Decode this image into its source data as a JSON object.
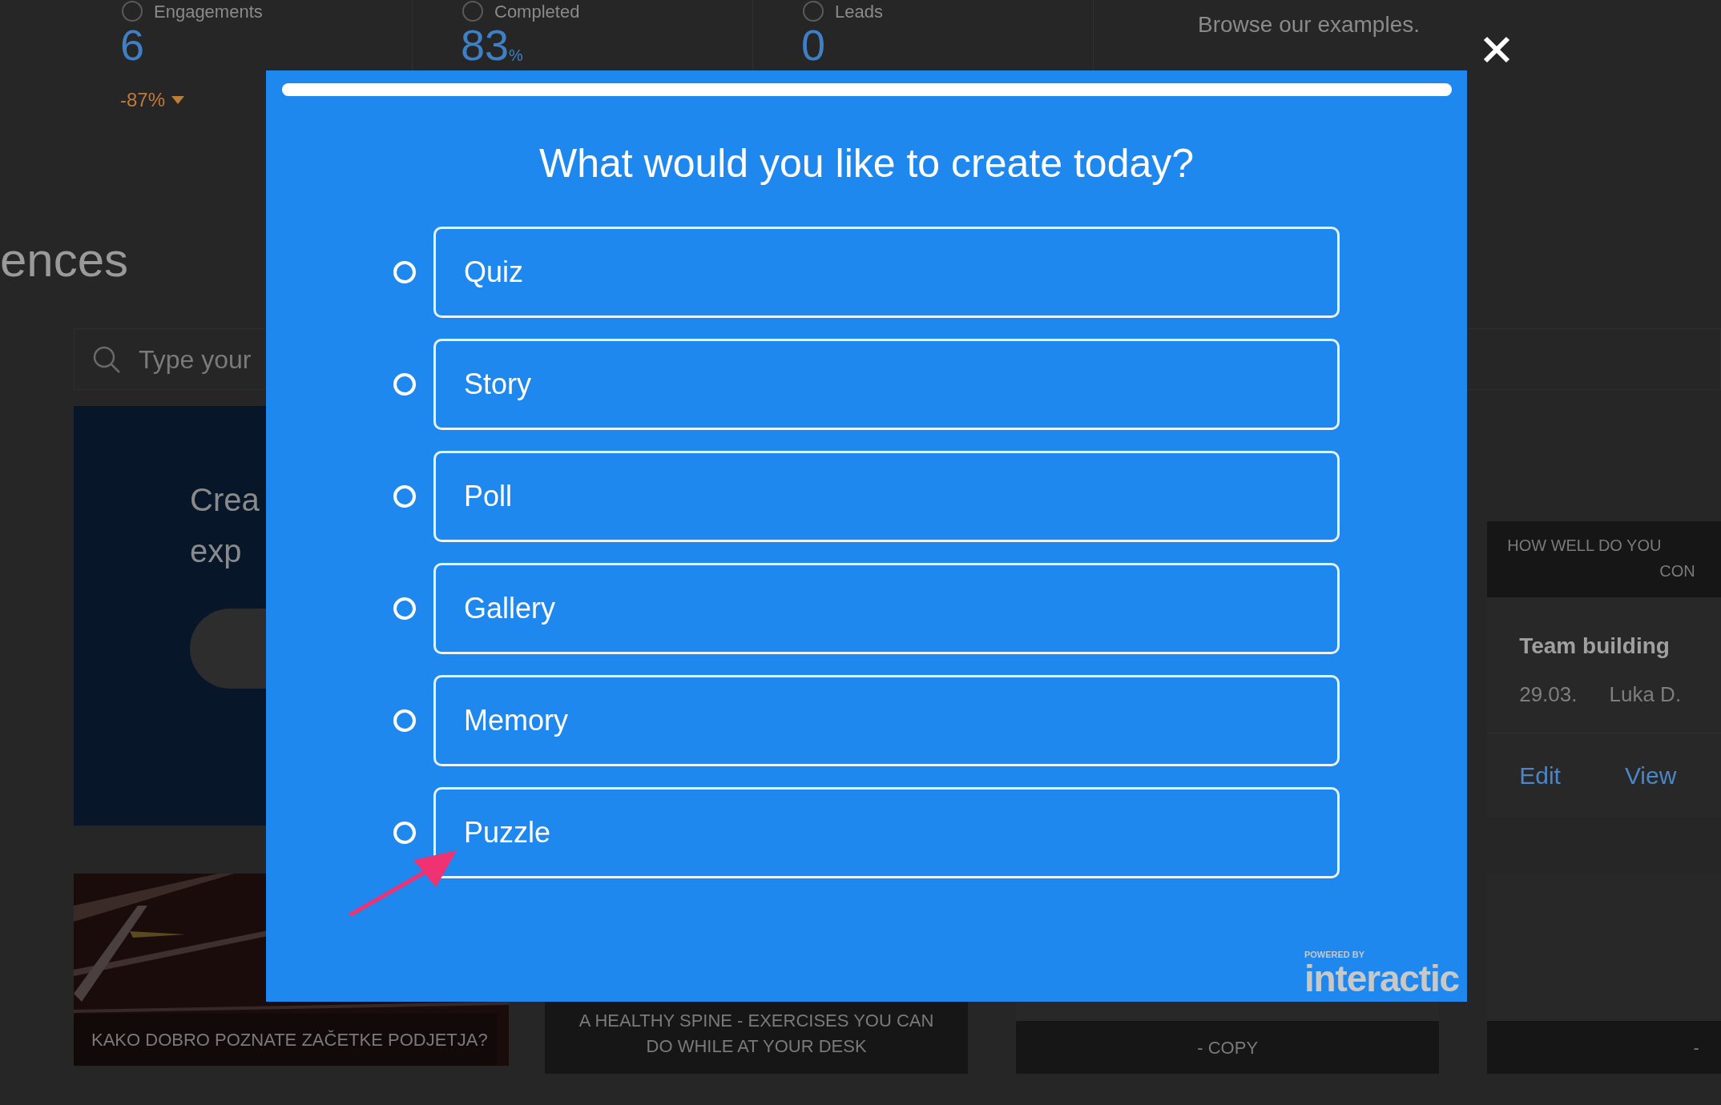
{
  "background": {
    "stats": [
      {
        "label": "Engagements",
        "value": "6",
        "delta": "-87%"
      },
      {
        "label": "Completed",
        "value": "83",
        "unit": "%"
      },
      {
        "label": "Leads",
        "value": "0"
      }
    ],
    "browse_link": "Browse our examples.",
    "heading": "ences",
    "search": {
      "placeholder": "Type your"
    },
    "promo_card": {
      "lines": [
        "Crea",
        "exp"
      ]
    },
    "experience_card": {
      "banner": [
        "HOW WELL DO YOU",
        "CON"
      ],
      "title": "Team building",
      "date": "29.03.",
      "author": "Luka D.",
      "actions": [
        "Edit",
        "View"
      ]
    },
    "cards": [
      {
        "kind": "picture",
        "caption": "KAKO DOBRO POZNATE ZAČETKE PODJETJA?"
      },
      {
        "kind": "plain",
        "caption": "A HEALTHY SPINE - EXERCISES YOU CAN DO WHILE AT YOUR DESK"
      },
      {
        "kind": "bar",
        "caption": "- COPY"
      },
      {
        "kind": "bar",
        "caption": "-"
      }
    ]
  },
  "modal": {
    "progress": {
      "level": 1
    },
    "title": "What would you like to create today?",
    "options": [
      {
        "label": "Quiz",
        "selected": false
      },
      {
        "label": "Story",
        "selected": false
      },
      {
        "label": "Poll",
        "selected": false
      },
      {
        "label": "Gallery",
        "selected": false
      },
      {
        "label": "Memory",
        "selected": false
      },
      {
        "label": "Puzzle",
        "selected": false
      }
    ],
    "branding": {
      "caption": "POWERED BY",
      "logo": "interactic"
    }
  }
}
